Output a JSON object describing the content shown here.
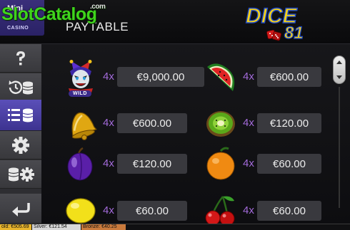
{
  "header": {
    "mini_label": "Mini",
    "casino_label": "CASINO",
    "title": "PAYTABLE",
    "game_logo": "DICE",
    "game_logo_number": "81"
  },
  "watermark": {
    "text": "SlotCatalog",
    "suffix": ".com"
  },
  "sidebar": {
    "items": [
      {
        "icon": "help-question-icon"
      },
      {
        "icon": "history-icon"
      },
      {
        "icon": "paytable-icon",
        "active": true
      },
      {
        "icon": "settings-gear-icon"
      },
      {
        "icon": "bet-settings-icon"
      },
      {
        "icon": "back-arrow-icon"
      }
    ]
  },
  "paytable": {
    "left": [
      {
        "symbol": "joker-wild",
        "label": "WILD",
        "multiplier": "4x",
        "amount": "€9,000.00"
      },
      {
        "symbol": "bell",
        "multiplier": "4x",
        "amount": "€600.00"
      },
      {
        "symbol": "plum",
        "multiplier": "4x",
        "amount": "€120.00"
      },
      {
        "symbol": "lemon",
        "multiplier": "4x",
        "amount": "€60.00"
      }
    ],
    "right": [
      {
        "symbol": "watermelon",
        "multiplier": "4x",
        "amount": "€600.00"
      },
      {
        "symbol": "kiwi",
        "multiplier": "4x",
        "amount": "€120.00"
      },
      {
        "symbol": "orange",
        "multiplier": "4x",
        "amount": "€60.00"
      },
      {
        "symbol": "cherries",
        "multiplier": "4x",
        "amount": "€60.00"
      }
    ]
  },
  "status": {
    "gold": "old: €505.69",
    "silver": "Silver: €121.54",
    "bronze": "Bronze: €40.25"
  },
  "colors": {
    "accent": "#3d3390",
    "multiplier": "#a26ad9",
    "watermark": "#3fd41c",
    "logo_yellow": "#f5d21a",
    "logo_outline": "#1d48c9"
  }
}
